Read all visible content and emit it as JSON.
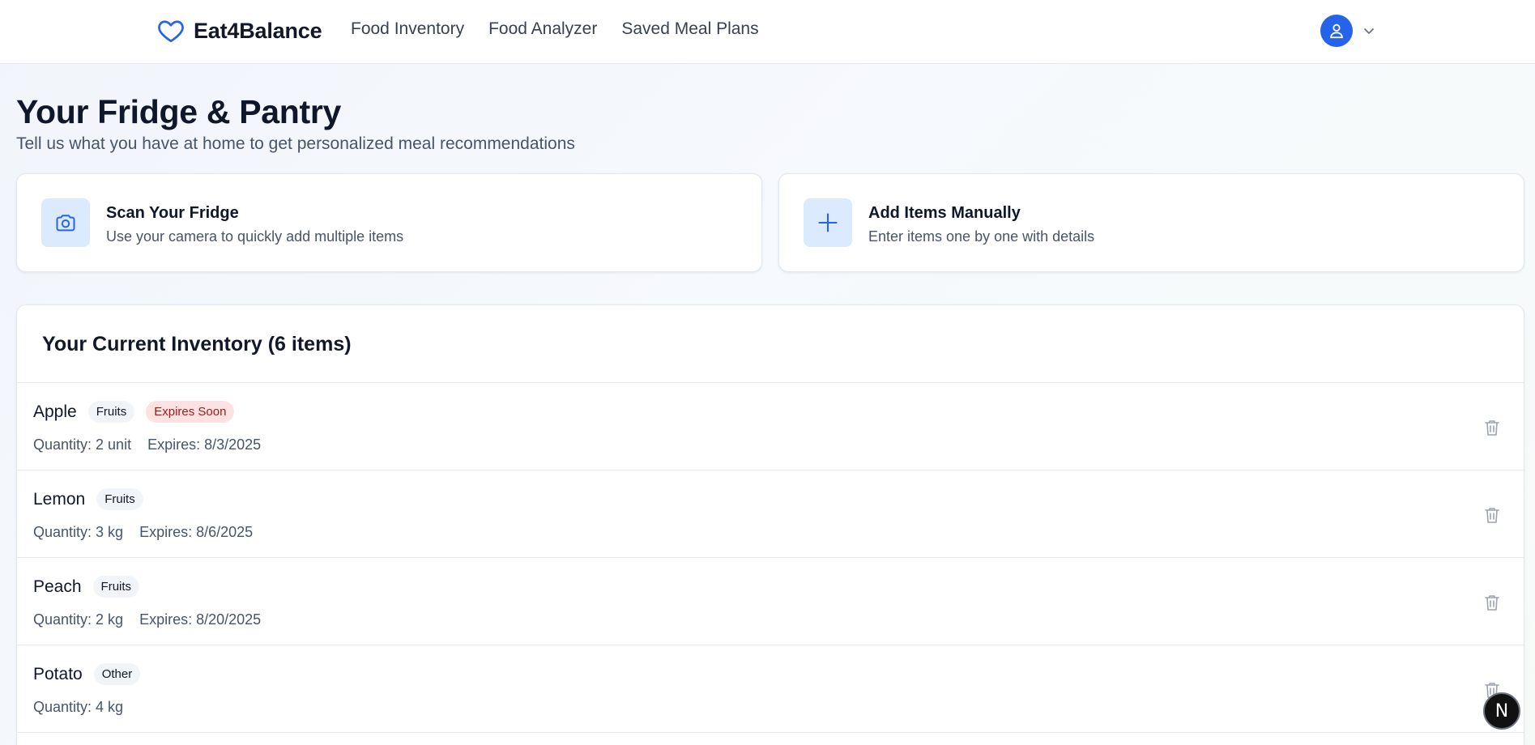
{
  "app": {
    "name": "Eat4Balance",
    "logo_icon": "heart-icon",
    "brand_color": "#2563eb"
  },
  "nav": {
    "items": [
      {
        "label": "Food Inventory"
      },
      {
        "label": "Food Analyzer"
      },
      {
        "label": "Saved Meal Plans"
      }
    ]
  },
  "user_menu": {
    "avatar_icon": "user-icon",
    "dropdown_icon": "chevron-down-icon"
  },
  "page": {
    "title": "Your Fridge & Pantry",
    "subtitle": "Tell us what you have at home to get personalized meal recommendations"
  },
  "actions": {
    "scan": {
      "icon": "camera-icon",
      "title": "Scan Your Fridge",
      "description": "Use your camera to quickly add multiple items"
    },
    "add_manual": {
      "icon": "plus-icon",
      "title": "Add Items Manually",
      "description": "Enter items one by one with details"
    }
  },
  "inventory": {
    "title": "Your Current Inventory (6 items)",
    "items": [
      {
        "name": "Apple",
        "category": "Fruits",
        "status": "Expires Soon",
        "quantity": "Quantity: 2 unit",
        "expires": "Expires: 8/3/2025"
      },
      {
        "name": "Lemon",
        "category": "Fruits",
        "status": null,
        "quantity": "Quantity: 3 kg",
        "expires": "Expires: 8/6/2025"
      },
      {
        "name": "Peach",
        "category": "Fruits",
        "status": null,
        "quantity": "Quantity: 2 kg",
        "expires": "Expires: 8/20/2025"
      },
      {
        "name": "Potato",
        "category": "Other",
        "status": null,
        "quantity": "Quantity: 4 kg",
        "expires": null
      }
    ],
    "delete_icon": "trash-icon"
  },
  "floating_button": {
    "label": "N",
    "icon": "next-logo-icon"
  },
  "colors": {
    "accent": "#2563eb",
    "accent_light": "#dbeafe",
    "warn_bg": "#fee2e2",
    "warn_text": "#991b1b",
    "badge_bg": "#f1f5f9"
  }
}
